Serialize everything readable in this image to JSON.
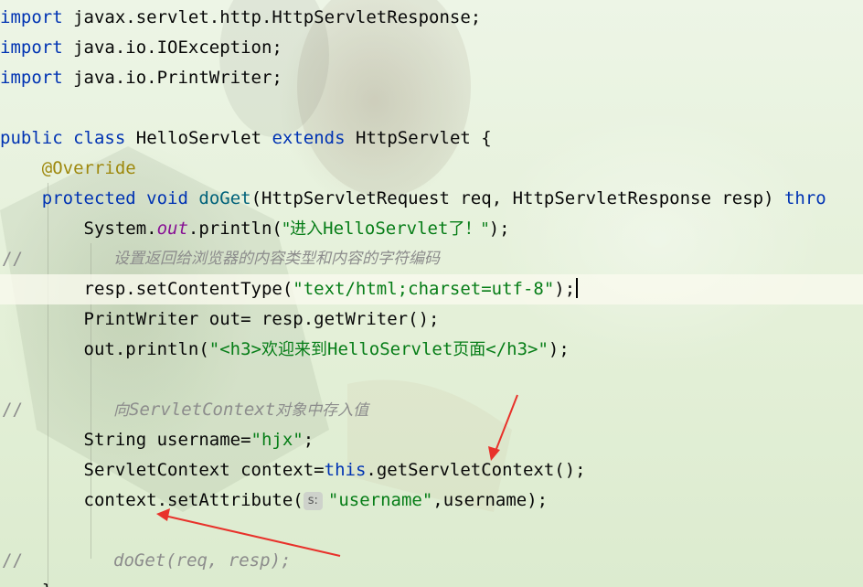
{
  "lines": [
    {
      "import_kw": "import",
      "path": " javax.servlet.http.HttpServletResponse;"
    },
    {
      "import_kw": "import",
      "path": " java.io.IOException;"
    },
    {
      "import_kw": "import",
      "path": " java.io.PrintWriter;"
    }
  ],
  "class_decl": {
    "public": "public",
    "class": "class",
    "name": "HelloServlet",
    "extends": "extends",
    "parent": "HttpServlet",
    "brace": " {"
  },
  "annotation": "@Override",
  "method_decl": {
    "protected": "protected",
    "void": "void",
    "name": "doGet",
    "params": "(HttpServletRequest req, HttpServletResponse resp) ",
    "throws": "thro"
  },
  "body": {
    "sysout_prefix": "System.",
    "sysout_field": "out",
    "sysout_call": ".println(",
    "sysout_str_a": "\"进入",
    "sysout_str_b": "HelloServlet",
    "sysout_str_c": "了！\"",
    "sysout_end": ");",
    "comment_slashes": "//",
    "comment_charset": "设置返回给浏览器的内容类型和内容的字符编码",
    "set_content_type_call": "resp.setContentType(",
    "set_content_type_arg": "\"text/html;charset=utf-8\"",
    "set_content_type_end": ");",
    "writer_line": "PrintWriter out= resp.getWriter();",
    "println_call": "out.println(",
    "println_str_a": "\"<h3>",
    "println_str_b": "欢迎来到",
    "println_str_c": "HelloServlet",
    "println_str_d": "页面",
    "println_str_e": "</h3>\"",
    "println_end": ");",
    "comment_ctx_a": "向",
    "comment_ctx_b": "ServletContext",
    "comment_ctx_c": "对象中存入值",
    "username_decl": "String username=",
    "username_value": "\"hjx\"",
    "username_end": ";",
    "ctx_decl": "ServletContext context=",
    "ctx_this": "this",
    "ctx_call": ".getServletContext();",
    "set_attr_call": "context.setAttribute(",
    "param_hint": "s:",
    "set_attr_arg": "\"username\"",
    "set_attr_end": ",username);",
    "comment_doget": "doGet(req, resp);",
    "closing_brace": "}"
  },
  "colors": {
    "keyword": "#0033b3",
    "string": "#067d17",
    "annotation": "#9e880d",
    "comment": "#8c8c8c",
    "field": "#871094",
    "arrow": "#e8312a"
  }
}
